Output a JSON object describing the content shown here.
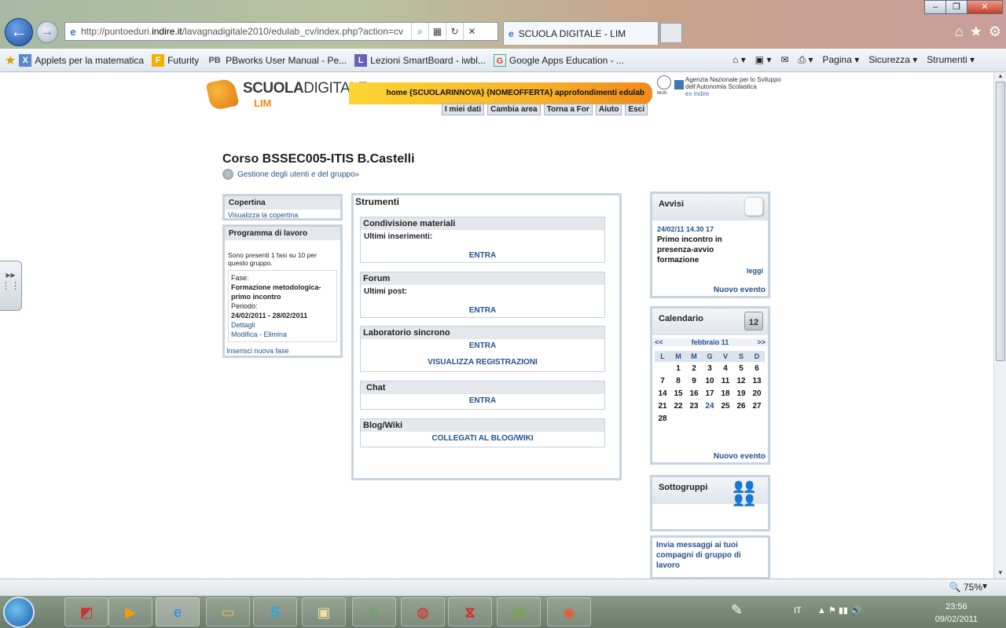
{
  "browser": {
    "address_prefix": "http://puntoeduri.",
    "address_domain": "indire.it",
    "address_suffix": "/lavagnadigitale2010/edulab_cv/index.php?action=cv",
    "tab_title": "SCUOLA DIGITALE - LIM",
    "favorites": [
      {
        "label": "Applets per la matematica",
        "icon": "X"
      },
      {
        "label": "Futurity",
        "icon": "F"
      },
      {
        "label": "PBworks User Manual - Pe...",
        "icon": "PB"
      },
      {
        "label": "Lezioni SmartBoard - iwbl...",
        "icon": "L"
      },
      {
        "label": "Google Apps Education - ...",
        "icon": "G"
      }
    ],
    "commands": {
      "pagina": "Pagina",
      "sicurezza": "Sicurezza",
      "strumenti": "Strumenti"
    },
    "zoom": "75%"
  },
  "site": {
    "logo_main_bold": "SCUOLA",
    "logo_main_light": "DIGITALE",
    "logo_sub": "LIM",
    "topnav": "home {SCUOLARINNOVA} {NOMEOFFERTA} approfondimenti edulab",
    "subnav": [
      "I miei dati",
      "Cambia area",
      "Torna a For",
      "Aiuto",
      "Esci"
    ],
    "agency_seal": "MIUR",
    "agency_text": "Agenzia Nazionale per lo Sviluppo dell'Autonomia Scolastica",
    "agency_sub": "ex indire"
  },
  "course": {
    "title": "Corso BSSEC005-ITIS B.Castelli",
    "subtitle": "Gestione degli utenti e del gruppo»"
  },
  "left": {
    "copertina_title": "Copertina",
    "copertina_link": "Visualizza la copertina",
    "programma_title": "Programma di lavoro",
    "programma_info": "Sono presenti 1 fasi su 10 per questo gruppo.",
    "fase_label": "Fase:",
    "fase_value": "Formazione metodologica-primo incontro",
    "periodo_label": "Periodo:",
    "periodo_value": "24/02/2011 - 28/02/2011",
    "dettagli": "Dettagli",
    "modifica": "Modifica - Elimina",
    "inserisci": "Inserisci nuova fase"
  },
  "strumenti": {
    "title": "Strumenti",
    "condivisione": {
      "title": "Condivisione materiali",
      "label": "Ultimi inserimenti:",
      "action": "ENTRA"
    },
    "forum": {
      "title": "Forum",
      "label": "Ultimi post:",
      "action": "ENTRA"
    },
    "lab": {
      "title": "Laboratorio sincrono",
      "action": "ENTRA",
      "action2": "VISUALIZZA REGISTRAZIONI"
    },
    "chat": {
      "title": "Chat",
      "action": "ENTRA"
    },
    "blog": {
      "title": "Blog/Wiki",
      "action": "COLLEGATI AL BLOG/WIKI"
    }
  },
  "avvisi": {
    "title": "Avvisi",
    "date": "24/02/11 14.30 17",
    "text": "Primo incontro in presenza-avvio formazione",
    "leggi": "leggi",
    "nuovo": "Nuovo evento"
  },
  "calendario": {
    "title": "Calendario",
    "icon_text": "12",
    "prev": "<<",
    "month": "febbraio 11",
    "next": ">>",
    "days": [
      "L",
      "M",
      "M",
      "G",
      "V",
      "S",
      "D"
    ],
    "weeks": [
      [
        "",
        "1",
        "2",
        "3",
        "4",
        "5",
        "6"
      ],
      [
        "7",
        "8",
        "9",
        "10",
        "11",
        "12",
        "13"
      ],
      [
        "14",
        "15",
        "16",
        "17",
        "18",
        "19",
        "20"
      ],
      [
        "21",
        "22",
        "23",
        "24",
        "25",
        "26",
        "27"
      ],
      [
        "28",
        "",
        "",
        "",
        "",
        "",
        ""
      ]
    ],
    "highlight": "24",
    "nuovo": "Nuovo evento"
  },
  "sottogruppi": {
    "title": "Sottogruppi"
  },
  "invia": {
    "text": "Invia messaggi ai tuoi compagni di gruppo di lavoro"
  },
  "taskbar": {
    "lang": "IT",
    "time": "23:56",
    "date": "09/02/2011"
  }
}
